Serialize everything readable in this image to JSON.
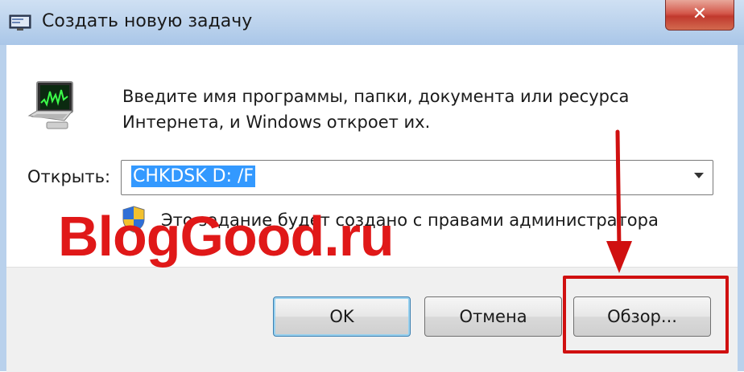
{
  "window": {
    "title": "Создать новую задачу",
    "close_symbol": "✕"
  },
  "dialog": {
    "description_line1": "Введите имя программы, папки, документа или ресурса",
    "description_line2": "Интернета, и Windows откроет их.",
    "open_label": "Открыть:",
    "open_value": "CHKDSK D: /F",
    "admin_note": "Это задание будет создано с правами администратора"
  },
  "buttons": {
    "ok_label": "OK",
    "cancel_label": "Отмена",
    "browse_label": "Обзор..."
  },
  "watermark": {
    "text": "BlogGood.ru",
    "color": "#e01818"
  },
  "annotation": {
    "highlight_color": "#d01010"
  },
  "icons": {
    "title": "task-manager-icon",
    "program": "monitor-chart-icon",
    "shield": "uac-shield-icon",
    "dropdown": "chevron-down-icon",
    "close": "close-icon"
  }
}
